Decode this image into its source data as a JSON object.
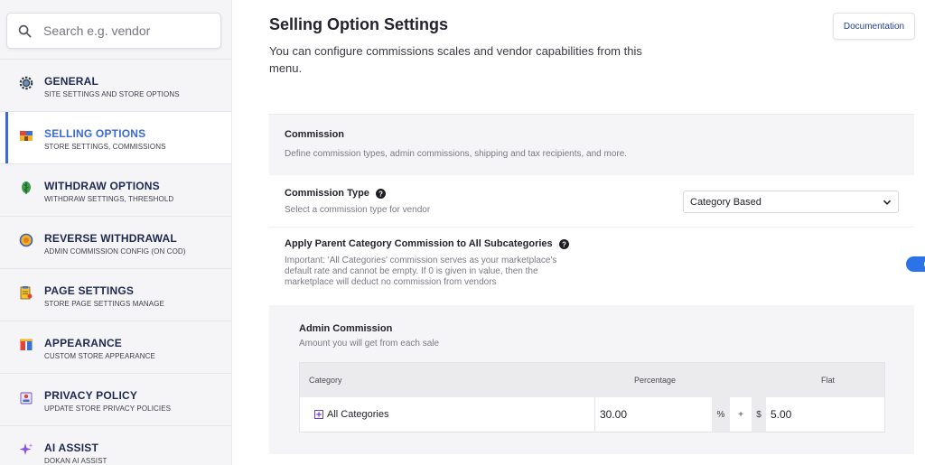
{
  "search": {
    "placeholder": "Search e.g. vendor"
  },
  "sidebar": {
    "items": [
      {
        "title": "GENERAL",
        "subtitle": "SITE SETTINGS AND STORE OPTIONS",
        "icon": "gear-icon"
      },
      {
        "title": "SELLING OPTIONS",
        "subtitle": "STORE SETTINGS, COMMISSIONS",
        "icon": "store-icon",
        "active": true
      },
      {
        "title": "WITHDRAW OPTIONS",
        "subtitle": "WITHDRAW SETTINGS, THRESHOLD",
        "icon": "leaf-icon"
      },
      {
        "title": "REVERSE WITHDRAWAL",
        "subtitle": "ADMIN COMMISSION CONFIG (ON COD)",
        "icon": "coin-icon"
      },
      {
        "title": "PAGE SETTINGS",
        "subtitle": "STORE PAGE SETTINGS MANAGE",
        "icon": "page-icon"
      },
      {
        "title": "APPEARANCE",
        "subtitle": "CUSTOM STORE APPEARANCE",
        "icon": "appearance-icon"
      },
      {
        "title": "PRIVACY POLICY",
        "subtitle": "UPDATE STORE PRIVACY POLICIES",
        "icon": "privacy-icon"
      },
      {
        "title": "AI ASSIST",
        "subtitle": "DOKAN AI ASSIST",
        "icon": "sparkle-icon"
      }
    ]
  },
  "header": {
    "title": "Selling Option Settings",
    "description": "You can configure commissions scales and vendor capabilities from this menu.",
    "documentation_label": "Documentation"
  },
  "commission": {
    "heading": "Commission",
    "description": "Define commission types, admin commissions, shipping and tax recipients, and more."
  },
  "commission_type": {
    "label": "Commission Type",
    "description": "Select a commission type for vendor",
    "selected": "Category Based"
  },
  "apply_parent": {
    "label": "Apply Parent Category Commission to All Subcategories",
    "description_lines": [
      "Important: 'All Categories' commission serves as your marketplace's",
      "default rate and cannot be empty. If 0 is given in value, then the",
      "marketplace will deduct no commission from vendors"
    ],
    "enabled": true
  },
  "admin_commission": {
    "title": "Admin Commission",
    "description": "Amount you will get from each sale",
    "columns": [
      "Category",
      "Percentage",
      "Flat"
    ],
    "row": {
      "category": "All Categories",
      "percentage": "30.00",
      "percent_symbol": "%",
      "plus_symbol": "+",
      "currency_symbol": "$",
      "flat": "5.00"
    }
  },
  "colors": {
    "accent": "#3b6ad6",
    "toggle_on": "#2b73e6",
    "nav_title": "#1d2950"
  }
}
